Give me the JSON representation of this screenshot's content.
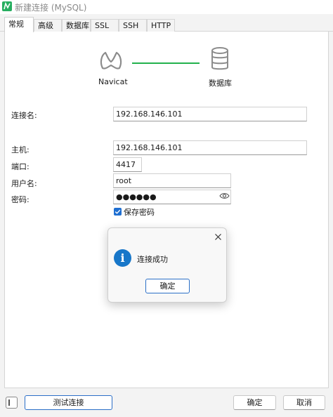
{
  "window": {
    "title": "新建连接 (MySQL)"
  },
  "tabs": [
    {
      "label": "常规",
      "active": true
    },
    {
      "label": "高级",
      "active": false
    },
    {
      "label": "数据库",
      "active": false
    },
    {
      "label": "SSL",
      "active": false
    },
    {
      "label": "SSH",
      "active": false
    },
    {
      "label": "HTTP",
      "active": false
    }
  ],
  "diagram": {
    "client_label": "Navicat",
    "server_label": "数据库",
    "line_color": "#22b14c"
  },
  "form": {
    "connection_name": {
      "label": "连接名:",
      "value": "192.168.146.101"
    },
    "host": {
      "label": "主机:",
      "value": "192.168.146.101"
    },
    "port": {
      "label": "端口:",
      "value": "4417"
    },
    "username": {
      "label": "用户名:",
      "value": "root"
    },
    "password": {
      "label": "密码:",
      "value": "●●●●●●"
    },
    "save_password": {
      "label": "保存密码",
      "checked": true
    }
  },
  "dialog": {
    "message": "连接成功",
    "ok_label": "确定",
    "icon": "info-icon"
  },
  "footer": {
    "test_label": "测试连接",
    "ok_label": "确定",
    "cancel_label": "取消"
  },
  "colors": {
    "accent": "#1f6fd1",
    "info": "#1877c9",
    "app_green": "#27ae60"
  }
}
